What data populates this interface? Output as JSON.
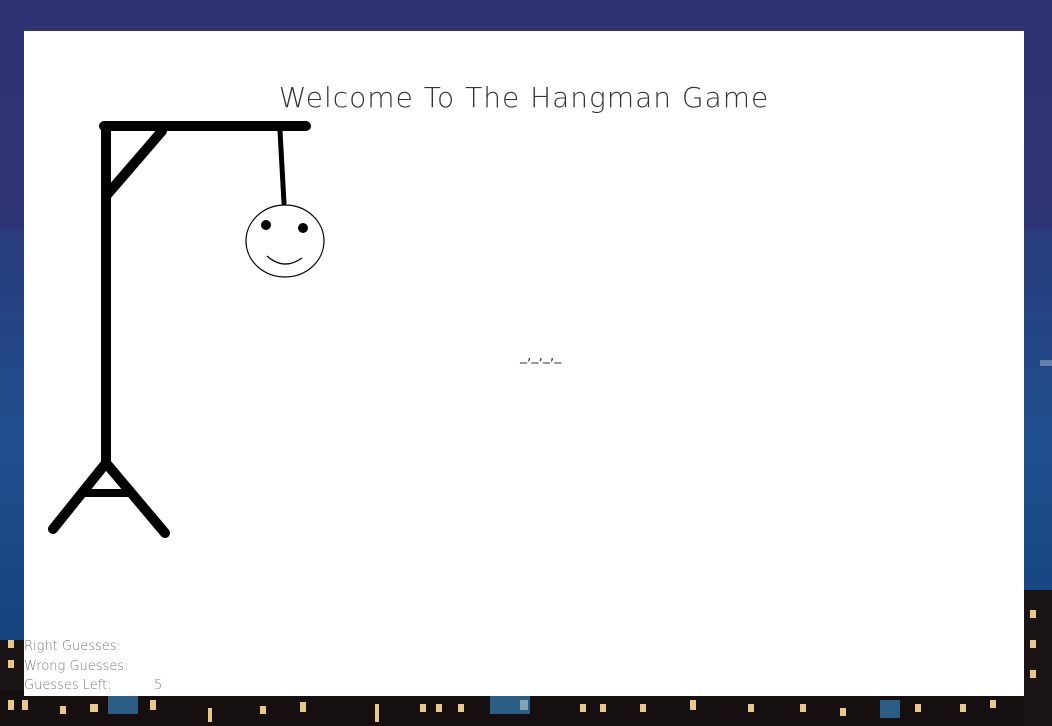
{
  "game": {
    "title": "Welcome To The Hangman Game",
    "word_display": "_,_,_,_"
  },
  "stats": {
    "right_label": "Right Guesses:",
    "right_value": "",
    "wrong_label": "Wrong Guesses:",
    "wrong_value": "",
    "left_label": "Guesses Left:",
    "left_value": "5"
  },
  "colors": {
    "background_top": "#2e3470",
    "background_bottom": "#0f3f78",
    "panel": "#ffffff",
    "ink": "#000000",
    "text": "#333333",
    "stat_text": "#777777"
  }
}
